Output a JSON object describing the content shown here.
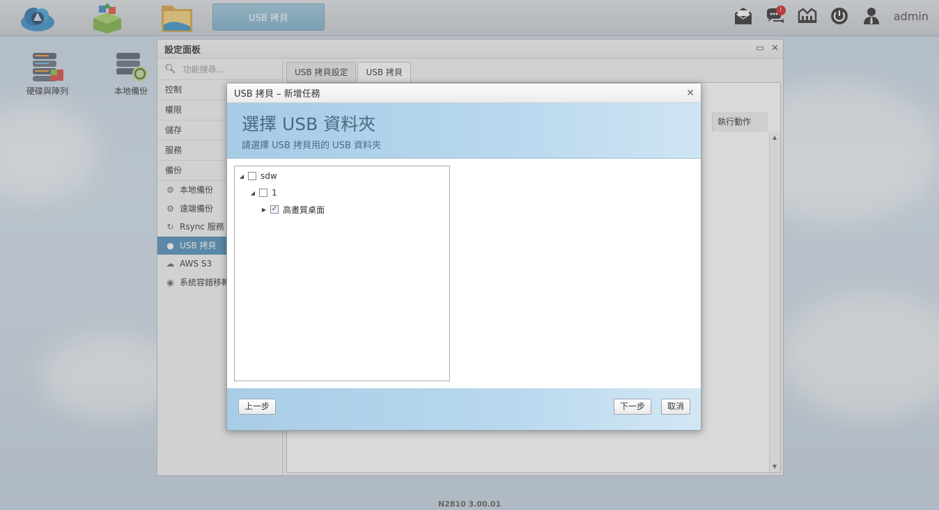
{
  "topbar": {
    "task_label": "USB 拷貝",
    "user": "admin",
    "notification_count": "!",
    "icons": [
      "mail-icon",
      "chat-icon",
      "network-icon",
      "power-icon",
      "user-icon"
    ]
  },
  "desktop": {
    "icons": [
      {
        "label": "硬碟與陣列"
      },
      {
        "label": "本地備份"
      }
    ]
  },
  "control_panel": {
    "title": "設定面板",
    "search_placeholder": "功能搜尋...",
    "categories": [
      "控制",
      "權限",
      "儲存",
      "服務",
      "備份"
    ],
    "backup_items": [
      {
        "label": "本地備份",
        "icon": "gear-sync-icon"
      },
      {
        "label": "遠端備份",
        "icon": "gear-remote-icon"
      },
      {
        "label": "Rsync 服務",
        "icon": "sync-icon"
      },
      {
        "label": "USB 拷貝",
        "icon": "usb-icon",
        "active": true
      },
      {
        "label": "AWS S3",
        "icon": "cloud-icon"
      },
      {
        "label": "系統容錯移轉",
        "icon": "failover-icon"
      }
    ],
    "tabs": [
      "USB 拷貝設定",
      "USB 拷貝"
    ],
    "active_tab": "USB 拷貝",
    "column_header": "執行動作"
  },
  "modal": {
    "title": "USB 拷貝 – 新增任務",
    "heading": "選擇 USB 資料夾",
    "subheading": "請選擇 USB 拷貝用的 USB 資料夾",
    "tree": [
      {
        "label": "sdw",
        "level": 0,
        "expanded": true,
        "checked": false
      },
      {
        "label": "1",
        "level": 1,
        "expanded": true,
        "checked": false
      },
      {
        "label": "高畫質桌面",
        "level": 2,
        "expanded": false,
        "checked": true
      }
    ],
    "buttons": {
      "prev": "上一步",
      "next": "下一步",
      "cancel": "取消"
    }
  },
  "footer": {
    "version": "N2810 3.00.01"
  }
}
